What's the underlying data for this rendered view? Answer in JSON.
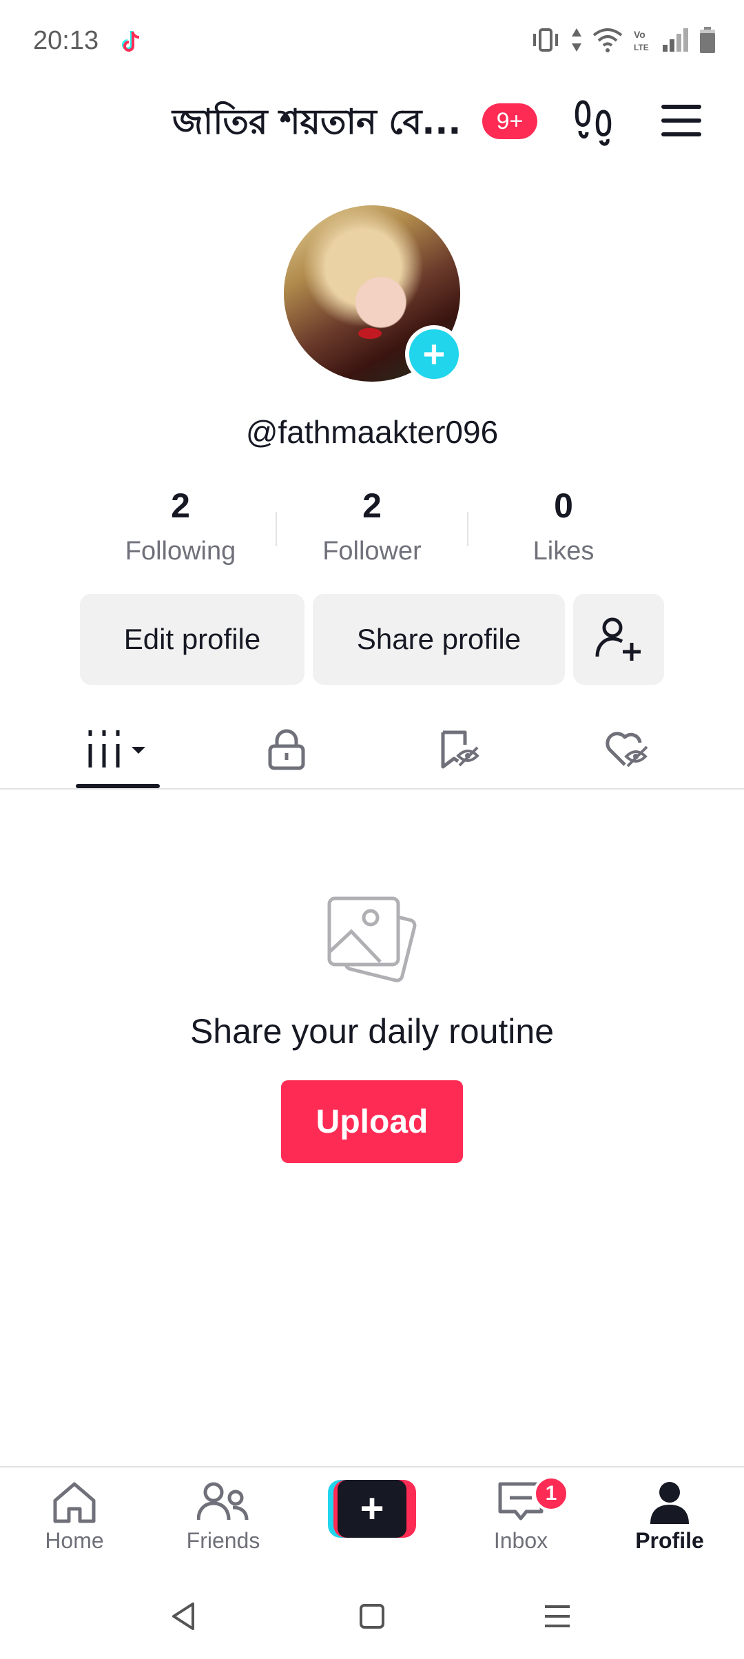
{
  "status_bar": {
    "time": "20:13",
    "icons": [
      "tiktok-notification-icon",
      "vibrate-icon",
      "data-arrows-icon",
      "wifi-icon",
      "volte-icon",
      "signal-icon",
      "battery-icon"
    ]
  },
  "header": {
    "profile_name": "জাতির শয়তান বে...",
    "notification_badge": "9+"
  },
  "profile": {
    "username": "@fathmaakter096"
  },
  "stats": [
    {
      "value": "2",
      "label": "Following"
    },
    {
      "value": "2",
      "label": "Follower"
    },
    {
      "value": "0",
      "label": "Likes"
    }
  ],
  "actions": {
    "edit_profile": "Edit profile",
    "share_profile": "Share profile"
  },
  "tabs": [
    "videos-grid-icon",
    "lock-icon",
    "favorites-hidden-icon",
    "liked-hidden-icon"
  ],
  "empty_state": {
    "title": "Share your daily routine",
    "upload": "Upload"
  },
  "bottom_nav": {
    "home": "Home",
    "friends": "Friends",
    "inbox": "Inbox",
    "inbox_badge": "1",
    "profile": "Profile"
  },
  "colors": {
    "accent_red": "#fe2c55",
    "accent_cyan": "#20d5ec",
    "text_primary": "#161823",
    "text_secondary": "#6f7079",
    "button_bg": "#f1f1f2"
  }
}
